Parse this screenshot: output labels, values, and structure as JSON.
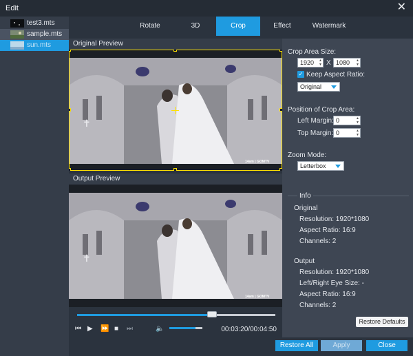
{
  "window": {
    "title": "Edit",
    "close_glyph": "✕"
  },
  "files": [
    {
      "name": "test3.mts",
      "icon": "video-thumbnail-icon"
    },
    {
      "name": "sample.mts",
      "icon": "video-thumbnail-icon"
    },
    {
      "name": "sun.mts",
      "icon": "video-thumbnail-icon",
      "selected": true
    }
  ],
  "tabs": [
    {
      "label": "Rotate"
    },
    {
      "label": "3D"
    },
    {
      "label": "Crop",
      "active": true
    },
    {
      "label": "Effect"
    },
    {
      "label": "Watermark"
    }
  ],
  "preview": {
    "original_label": "Original Preview",
    "output_label": "Output Preview",
    "watermark": "14am | GOMTV"
  },
  "player": {
    "timecode": "00:03:20/00:04:50",
    "progress": 0.68,
    "volume": 0.8
  },
  "crop": {
    "area_size_label": "Crop Area Size:",
    "width": "1920",
    "x_label": "X",
    "height": "1080",
    "keep_aspect_label": "Keep Aspect Ratio:",
    "keep_aspect_checked": true,
    "aspect_value": "Original",
    "position_label": "Position of Crop Area:",
    "left_margin_label": "Left Margin:",
    "left_margin": "0",
    "top_margin_label": "Top Margin:",
    "top_margin": "0",
    "zoom_label": "Zoom Mode:",
    "zoom_value": "Letterbox"
  },
  "info": {
    "title": "Info",
    "original_title": "Original",
    "original_resolution": "Resolution: 1920*1080",
    "original_aspect": "Aspect Ratio: 16:9",
    "original_channels": "Channels: 2",
    "output_title": "Output",
    "output_resolution": "Resolution: 1920*1080",
    "output_eye_size": "Left/Right Eye Size: -",
    "output_aspect": "Aspect Ratio: 16:9",
    "output_channels": "Channels: 2"
  },
  "buttons": {
    "restore_defaults": "Restore Defaults",
    "restore_all": "Restore All",
    "apply": "Apply",
    "close": "Close"
  },
  "colors": {
    "accent": "#1f9be0",
    "crop_frame": "#ffe100"
  }
}
